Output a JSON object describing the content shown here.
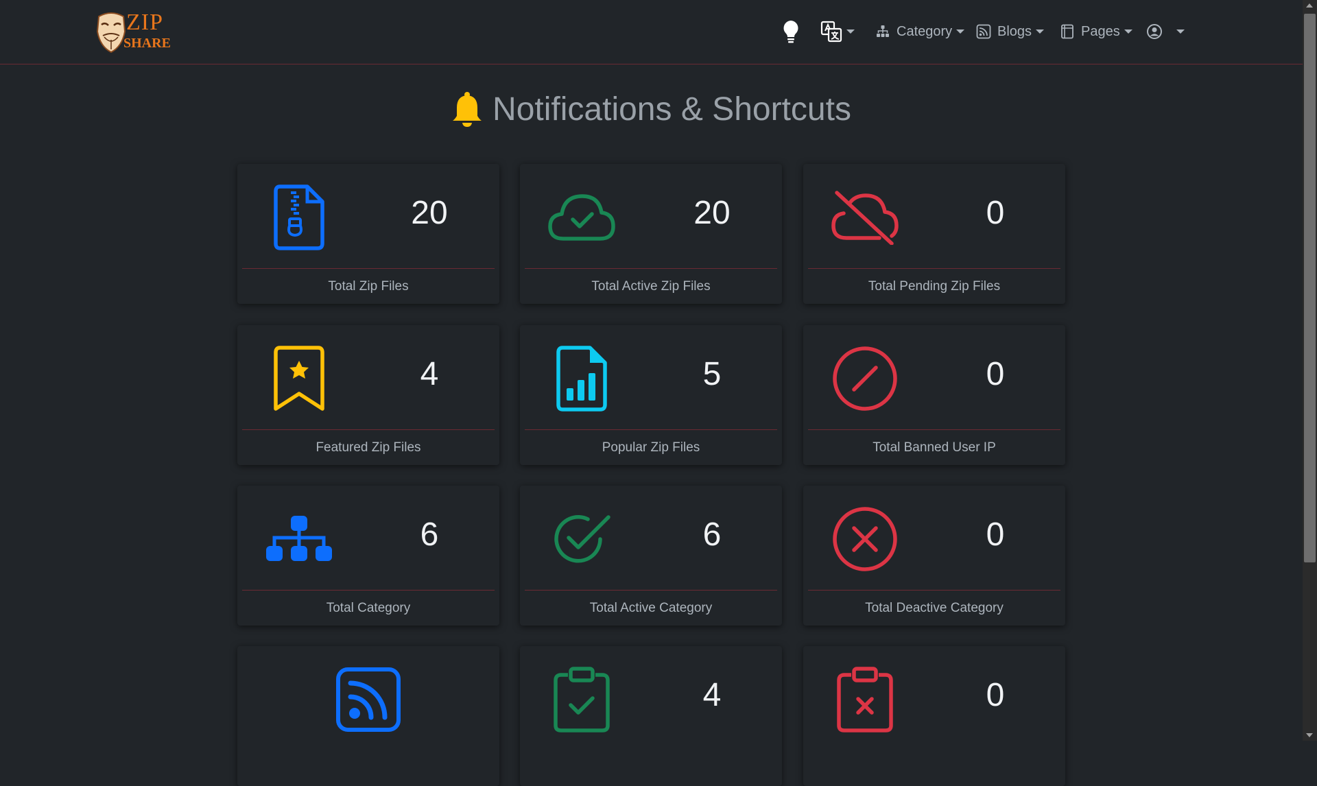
{
  "brand": {
    "line1": "ZIP",
    "line2": "SHARE"
  },
  "nav": {
    "category_label": "Category",
    "blogs_label": "Blogs",
    "pages_label": "Pages"
  },
  "heading": {
    "title": "Notifications & Shortcuts"
  },
  "colors": {
    "blue": "#0d6efd",
    "green": "#198754",
    "red": "#dc3545",
    "yellow": "#ffc107",
    "cyan": "#0dcaf0"
  },
  "cards": [
    {
      "count": "20",
      "label": "Total Zip Files",
      "icon": "zip-file-icon"
    },
    {
      "count": "20",
      "label": "Total Active Zip Files",
      "icon": "cloud-check-icon"
    },
    {
      "count": "0",
      "label": "Total Pending Zip Files",
      "icon": "cloud-slash-icon"
    },
    {
      "count": "4",
      "label": "Featured Zip Files",
      "icon": "bookmark-star-icon"
    },
    {
      "count": "5",
      "label": "Popular Zip Files",
      "icon": "file-bar-chart-icon"
    },
    {
      "count": "0",
      "label": "Total Banned User IP",
      "icon": "slash-circle-icon"
    },
    {
      "count": "6",
      "label": "Total Category",
      "icon": "diagram-icon"
    },
    {
      "count": "6",
      "label": "Total Active Category",
      "icon": "check-circle-icon"
    },
    {
      "count": "0",
      "label": "Total Deactive Category",
      "icon": "x-circle-icon"
    },
    {
      "count": "",
      "label": "",
      "icon": "rss-icon"
    },
    {
      "count": "4",
      "label": "",
      "icon": "clipboard-check-icon"
    },
    {
      "count": "0",
      "label": "",
      "icon": "clipboard-x-icon"
    }
  ]
}
